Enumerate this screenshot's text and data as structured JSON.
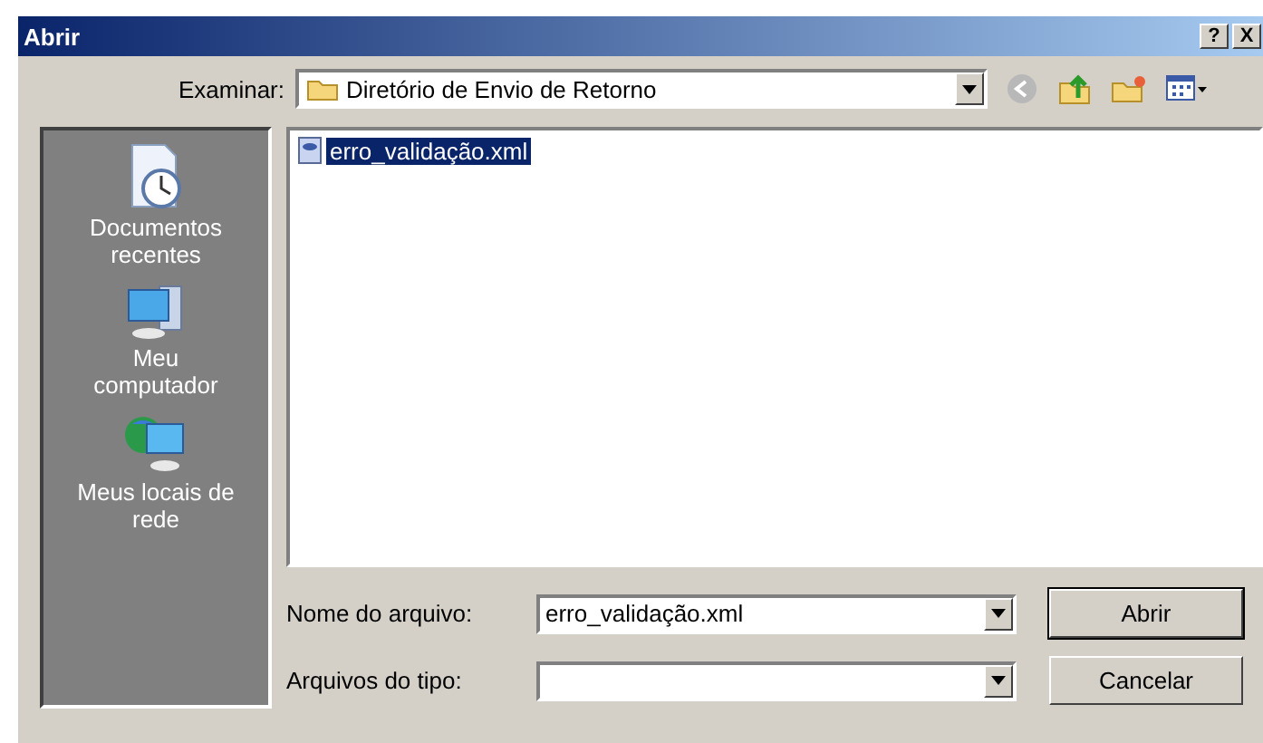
{
  "window": {
    "title": "Abrir",
    "help_button": "?",
    "close_button": "X"
  },
  "location": {
    "label": "Examinar:",
    "value": "Diretório de Envio de Retorno"
  },
  "places": [
    {
      "label": "Documentos recentes",
      "kind": "recent"
    },
    {
      "label": "Meu computador",
      "kind": "computer"
    },
    {
      "label": "Meus locais de rede",
      "kind": "network"
    }
  ],
  "files": [
    {
      "name": "erro_validação.xml",
      "selected": true
    }
  ],
  "file_name": {
    "label": "Nome do arquivo:",
    "value": "erro_validação.xml"
  },
  "file_type": {
    "label": "Arquivos do tipo:"
  },
  "buttons": [
    {
      "label": "Abrir",
      "default": true
    },
    {
      "label": "Cancelar",
      "default": false
    }
  ]
}
